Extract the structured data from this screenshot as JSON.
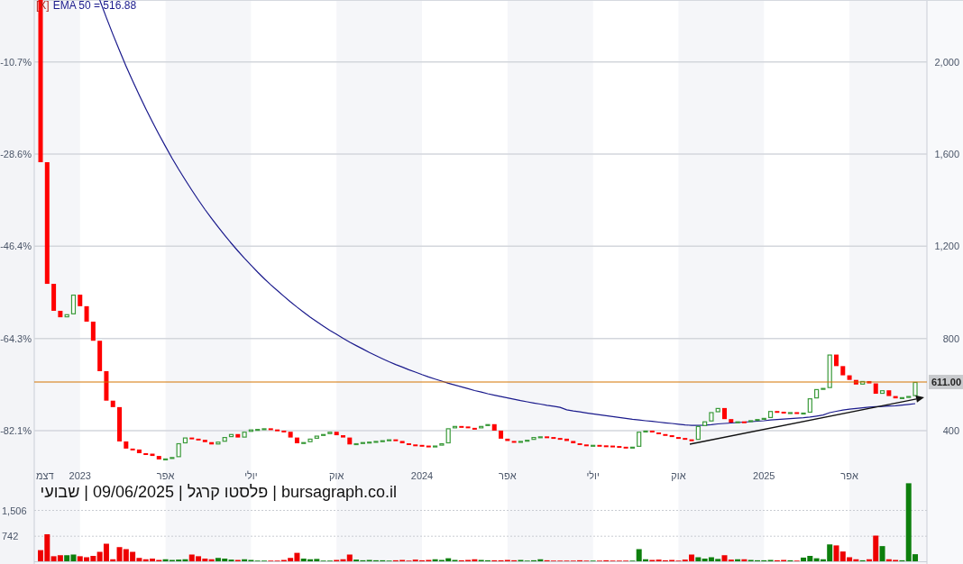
{
  "price_chart": {
    "legend": {
      "close": "[X]",
      "value": "= 516.88"
    },
    "percent_labels": [
      "-10.7%",
      "-28.6%",
      "-46.4%",
      "-64.3%",
      "-82.1%"
    ],
    "chart_data": {
      "type": "line",
      "grid": true,
      "ylim": [
        173,
        2269
      ],
      "categories": [
        "דצמ",
        null,
        null,
        null,
        null,
        null,
        "2023",
        null,
        null,
        null,
        null,
        null,
        null,
        null,
        null,
        null,
        null,
        null,
        null,
        "אפר",
        null,
        null,
        null,
        null,
        null,
        null,
        null,
        null,
        null,
        null,
        null,
        null,
        "יולי",
        null,
        null,
        null,
        null,
        null,
        null,
        null,
        null,
        null,
        null,
        null,
        null,
        "אוק",
        null,
        null,
        null,
        null,
        null,
        null,
        null,
        null,
        null,
        null,
        null,
        null,
        "2024",
        null,
        null,
        null,
        null,
        null,
        null,
        null,
        null,
        null,
        null,
        null,
        null,
        "אפר",
        null,
        null,
        null,
        null,
        null,
        null,
        null,
        null,
        null,
        null,
        null,
        null,
        "יולי",
        null,
        null,
        null,
        null,
        null,
        null,
        null,
        null,
        null,
        null,
        null,
        null,
        "אוק",
        null,
        null,
        null,
        null,
        null,
        null,
        null,
        null,
        null,
        null,
        null,
        null,
        "2025",
        null,
        null,
        null,
        null,
        null,
        null,
        null,
        null,
        null,
        null,
        null,
        null,
        "אפר",
        null,
        null,
        null,
        null,
        null,
        null,
        null,
        null,
        null,
        null
      ],
      "yticks": [
        {
          "value": 2000,
          "label": "2,000"
        },
        {
          "value": 1600,
          "label": "1,600"
        },
        {
          "value": 1200,
          "label": "1,200"
        },
        {
          "value": 800,
          "label": "800"
        },
        {
          "value": 400,
          "label": "400"
        }
      ],
      "series": [
        {
          "name": "EMA 50",
          "color": "#1a1a8c",
          "values": [
            null,
            null,
            null,
            null,
            null,
            null,
            null,
            null,
            null,
            2269,
            2193,
            2120,
            2050,
            1982,
            1918,
            1856,
            1797,
            1740,
            1685,
            1633,
            1582,
            1534,
            1488,
            1444,
            1401,
            1360,
            1321,
            1284,
            1248,
            1213,
            1180,
            1148,
            1118,
            1088,
            1060,
            1033,
            1008,
            983,
            959,
            936,
            914,
            893,
            873,
            854,
            835,
            818,
            801,
            784,
            769,
            754,
            739,
            725,
            712,
            699,
            687,
            676,
            664,
            654,
            643,
            633,
            624,
            615,
            606,
            598,
            590,
            582,
            574,
            567,
            560,
            554,
            548,
            542,
            536,
            530,
            525,
            520,
            515,
            510,
            506,
            501,
            490,
            485,
            481,
            477,
            473,
            469,
            465,
            461,
            457,
            453,
            449,
            446,
            443,
            440,
            437,
            434,
            431,
            428,
            425,
            423,
            423,
            424,
            426,
            429,
            431,
            433,
            435,
            437,
            439,
            441,
            443,
            446,
            448,
            450,
            452,
            454,
            456,
            459,
            463,
            468,
            478,
            484,
            489,
            493,
            496,
            499,
            502,
            504,
            505,
            507,
            508,
            511,
            514,
            517
          ]
        }
      ]
    },
    "last_price_tag": "611.00"
  },
  "title": "bursagraph.co.il | פלסטו קרגל | 09/06/2025 | שבועי",
  "volume_chart": {
    "chart_data": {
      "type": "bar",
      "grid": true,
      "ylim": [
        0,
        2320
      ],
      "yticks": [
        {
          "value": 1506,
          "label": "1,506"
        },
        {
          "value": 742,
          "label": "742"
        }
      ],
      "series": [
        {
          "values": [
            330,
            800,
            150,
            180,
            180,
            200,
            150,
            120,
            160,
            280,
            520,
            60,
            420,
            360,
            280,
            100,
            60,
            80,
            40,
            60,
            40,
            50,
            60,
            200,
            150,
            80,
            60,
            100,
            80,
            50,
            40,
            60,
            40,
            20,
            20,
            20,
            20,
            40,
            100,
            250,
            80,
            60,
            70,
            20,
            20,
            40,
            60,
            200,
            50,
            30,
            40,
            30,
            30,
            20,
            30,
            40,
            20,
            50,
            30,
            40,
            60,
            40,
            90,
            40,
            30,
            40,
            60,
            40,
            30,
            30,
            30,
            40,
            30,
            40,
            20,
            30,
            60,
            30,
            20,
            20,
            20,
            20,
            30,
            20,
            20,
            20,
            30,
            20,
            20,
            20,
            20,
            360,
            60,
            40,
            50,
            30,
            40,
            20,
            50,
            200,
            120,
            80,
            120,
            70,
            180,
            50,
            60,
            60,
            40,
            30,
            30,
            40,
            30,
            40,
            30,
            20,
            110,
            160,
            90,
            60,
            500,
            470,
            290,
            120,
            60,
            30,
            60,
            760,
            450,
            60,
            40,
            30,
            2310,
            210
          ]
        }
      ]
    }
  }
}
